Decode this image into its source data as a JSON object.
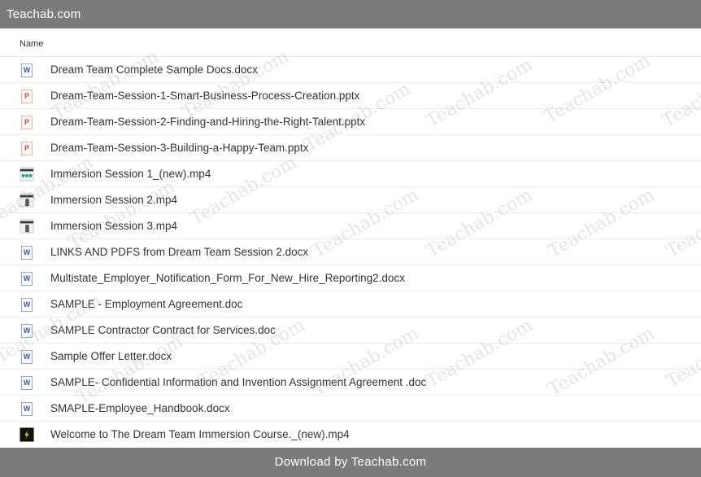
{
  "topbar": {
    "title": "Teachab.com"
  },
  "list": {
    "column_name": "Name",
    "files": [
      {
        "name": "Dream Team Complete Sample Docs.docx",
        "icon": "word-doc-icon",
        "glyph": "W"
      },
      {
        "name": "Dream-Team-Session-1-Smart-Business-Process-Creation.pptx",
        "icon": "powerpoint-icon",
        "glyph": "P"
      },
      {
        "name": "Dream-Team-Session-2-Finding-and-Hiring-the-Right-Talent.pptx",
        "icon": "powerpoint-icon",
        "glyph": "P"
      },
      {
        "name": "Dream-Team-Session-3-Building-a-Happy-Team.pptx",
        "icon": "powerpoint-icon",
        "glyph": "P"
      },
      {
        "name": "Immersion Session 1_(new).mp4",
        "icon": "video-thumbnail-icon",
        "glyph": ""
      },
      {
        "name": "Immersion Session 2.mp4",
        "icon": "video-thumbnail-icon",
        "glyph": ""
      },
      {
        "name": "Immersion Session 3.mp4",
        "icon": "video-thumbnail-icon",
        "glyph": ""
      },
      {
        "name": "LINKS AND PDFS from Dream Team Session 2.docx",
        "icon": "word-doc-icon",
        "glyph": "W"
      },
      {
        "name": "Multistate_Employer_Notification_Form_For_New_Hire_Reporting2.docx",
        "icon": "word-doc-icon",
        "glyph": "W"
      },
      {
        "name": "SAMPLE - Employment Agreement.doc",
        "icon": "word-doc-icon",
        "glyph": "W"
      },
      {
        "name": "SAMPLE Contractor Contract for Services.doc",
        "icon": "word-doc-icon",
        "glyph": "W"
      },
      {
        "name": "Sample Offer Letter.docx",
        "icon": "word-doc-icon",
        "glyph": "W"
      },
      {
        "name": "SAMPLE- Confidential Information and Invention Assignment Agreement .doc",
        "icon": "word-doc-icon",
        "glyph": "W"
      },
      {
        "name": "SMAPLE-Employee_Handbook.docx",
        "icon": "word-doc-icon",
        "glyph": "W"
      },
      {
        "name": "Welcome to The Dream Team Immersion Course._(new).mp4",
        "icon": "video-thumbnail-icon",
        "glyph": ""
      }
    ]
  },
  "footer": {
    "text": "Download by Teachab.com"
  },
  "watermark": {
    "text": "Teachab.com"
  }
}
